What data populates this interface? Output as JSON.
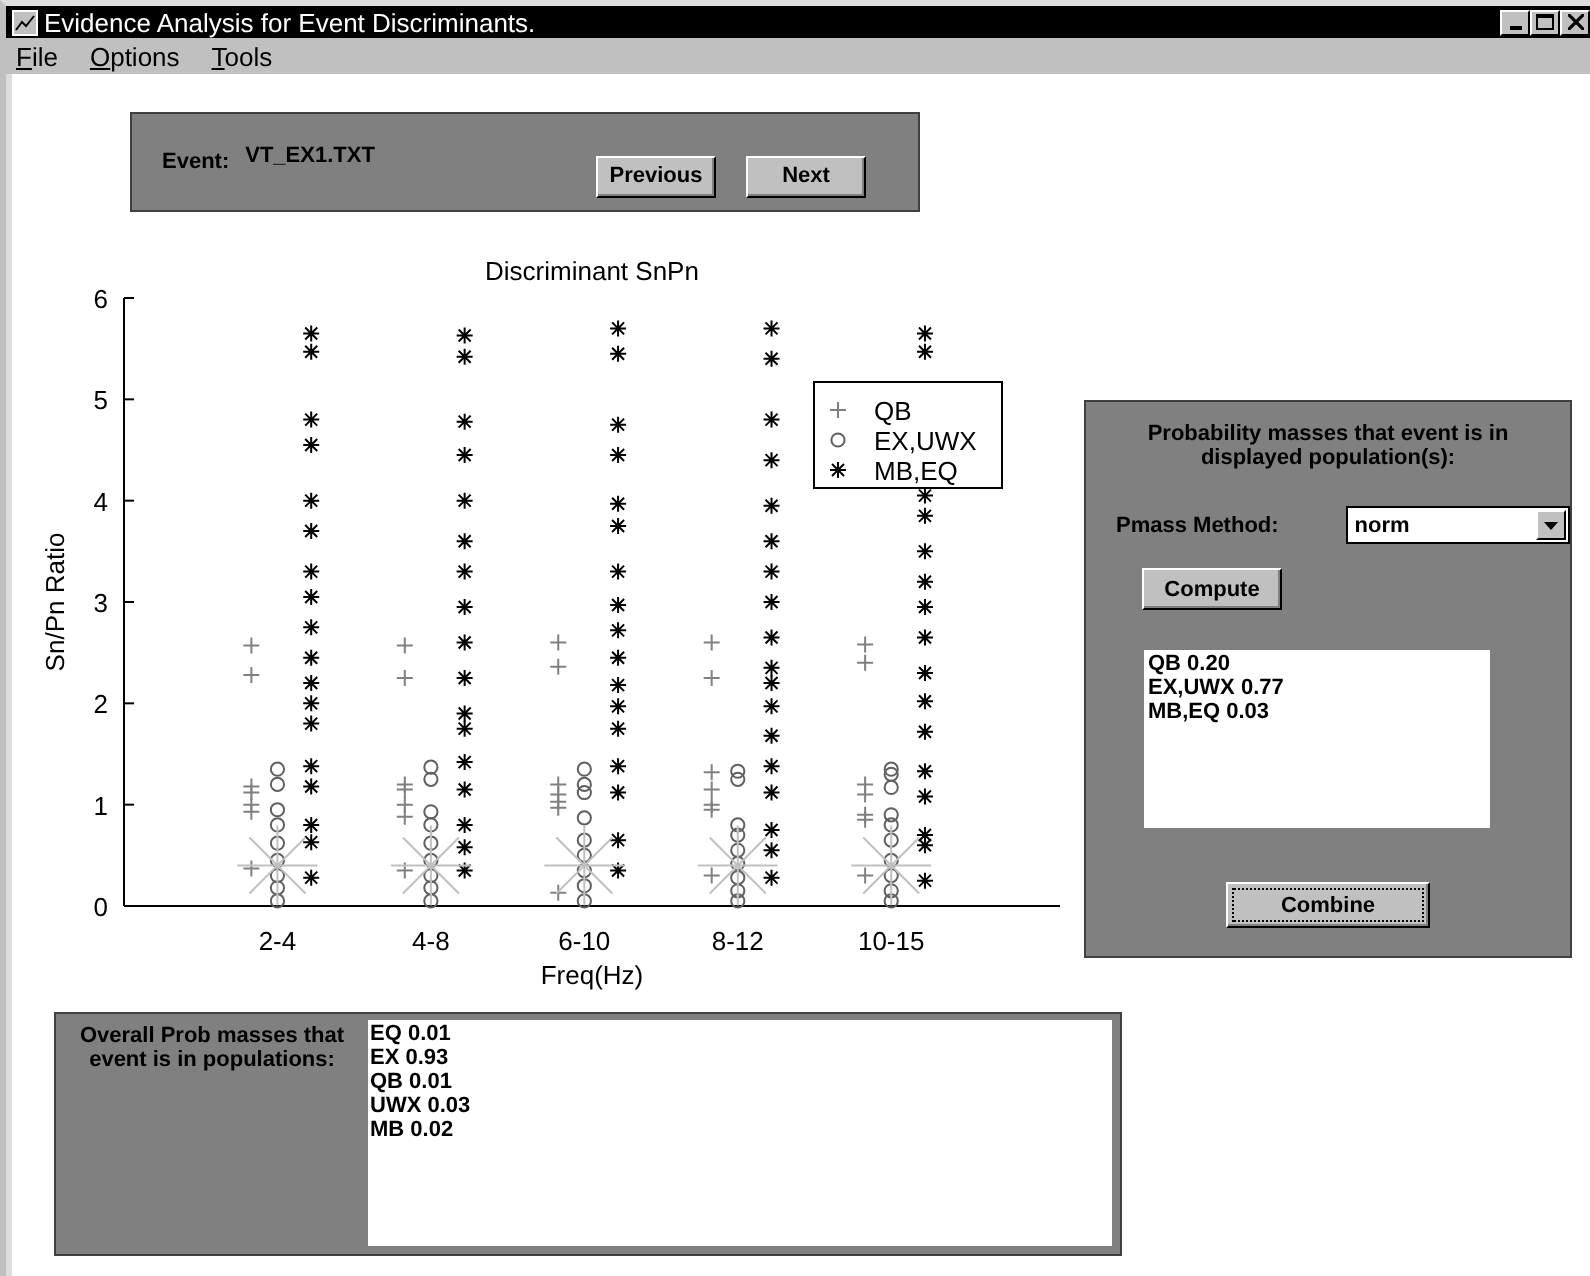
{
  "window": {
    "title": "Evidence Analysis for Event Discriminants."
  },
  "menu": [
    "File",
    "Options",
    "Tools"
  ],
  "event_panel": {
    "label": "Event:",
    "value": "VT_EX1.TXT",
    "buttons": [
      "Previous",
      "Next"
    ]
  },
  "chart": {
    "chart_data": {
      "type": "scatter",
      "title": "Discriminant  SnPn",
      "xlabel": "Freq(Hz)",
      "ylabel": "Sn/Pn Ratio",
      "legend": "upper right",
      "categories": [
        "2-4",
        "4-8",
        "6-10",
        "8-12",
        "10-15"
      ],
      "ylim": [
        0,
        6
      ],
      "yticks": [
        0,
        1,
        2,
        3,
        4,
        5,
        6
      ],
      "series": [
        {
          "name": "QB",
          "color": "#808080",
          "values": [
            2.57,
            2.57,
            2.6,
            2.6,
            2.58
          ]
        },
        {
          "color": "#808080",
          "values": [
            2.28,
            2.25,
            2.36,
            2.25,
            2.4
          ]
        },
        {
          "color": "#808080",
          "values": [
            1.18,
            1.2,
            1.2,
            1.32,
            1.2
          ]
        },
        {
          "color": "#808080",
          "values": [
            1.12,
            1.15,
            1.1,
            1.15,
            1.1
          ]
        },
        {
          "color": "#808080",
          "values": [
            1.0,
            1.0,
            1.03,
            1.0,
            0.9
          ]
        },
        {
          "color": "#808080",
          "values": [
            0.93,
            0.88,
            0.97,
            0.95,
            0.85
          ]
        },
        {
          "color": "#808080",
          "values": [
            0.37,
            0.35,
            0.13,
            0.3,
            0.3
          ]
        },
        {
          "name": "EX,UWX",
          "color": "#606060",
          "values": [
            1.35,
            1.37,
            1.35,
            1.33,
            1.35
          ]
        },
        {
          "color": "#606060",
          "values": [
            1.2,
            1.25,
            1.2,
            1.25,
            1.3
          ]
        },
        {
          "color": "#606060",
          "values": [
            0.95,
            0.93,
            1.12,
            0.8,
            1.17
          ]
        },
        {
          "color": "#606060",
          "values": [
            0.8,
            0.8,
            0.87,
            0.7,
            0.9
          ]
        },
        {
          "color": "#606060",
          "values": [
            0.62,
            0.62,
            0.65,
            0.55,
            0.8
          ]
        },
        {
          "color": "#606060",
          "values": [
            0.45,
            0.45,
            0.5,
            0.42,
            0.65
          ]
        },
        {
          "color": "#606060",
          "values": [
            0.3,
            0.3,
            0.35,
            0.28,
            0.45
          ]
        },
        {
          "color": "#606060",
          "values": [
            0.18,
            0.18,
            0.2,
            0.15,
            0.3
          ]
        },
        {
          "color": "#606060",
          "values": [
            0.05,
            0.05,
            0.05,
            0.05,
            0.15
          ]
        },
        {
          "color": "#606060",
          "values": [
            null,
            null,
            null,
            null,
            0.05
          ]
        },
        {
          "name": "MB,EQ",
          "color": "#000000",
          "values": [
            5.65,
            5.63,
            5.7,
            5.7,
            5.65
          ]
        },
        {
          "color": "#000000",
          "values": [
            5.47,
            5.42,
            5.45,
            5.4,
            5.47
          ]
        },
        {
          "color": "#000000",
          "values": [
            4.8,
            4.78,
            4.75,
            4.8,
            null
          ]
        },
        {
          "color": "#000000",
          "values": [
            4.55,
            4.45,
            4.45,
            4.4,
            4.05
          ]
        },
        {
          "color": "#000000",
          "values": [
            4.0,
            4.0,
            3.97,
            3.95,
            3.85
          ]
        },
        {
          "color": "#000000",
          "values": [
            3.7,
            3.6,
            3.75,
            3.6,
            3.5
          ]
        },
        {
          "color": "#000000",
          "values": [
            3.3,
            3.3,
            3.3,
            3.3,
            3.2
          ]
        },
        {
          "color": "#000000",
          "values": [
            3.05,
            2.95,
            2.97,
            3.0,
            2.95
          ]
        },
        {
          "color": "#000000",
          "values": [
            2.75,
            2.6,
            2.72,
            2.65,
            2.65
          ]
        },
        {
          "color": "#000000",
          "values": [
            2.45,
            2.25,
            2.45,
            2.35,
            2.3
          ]
        },
        {
          "color": "#000000",
          "values": [
            2.2,
            1.9,
            2.18,
            2.2,
            2.02
          ]
        },
        {
          "color": "#000000",
          "values": [
            2.0,
            1.75,
            1.97,
            1.97,
            1.72
          ]
        },
        {
          "color": "#000000",
          "values": [
            1.8,
            1.42,
            1.75,
            1.68,
            1.33
          ]
        },
        {
          "color": "#000000",
          "values": [
            1.38,
            1.15,
            1.38,
            1.38,
            1.08
          ]
        },
        {
          "color": "#000000",
          "values": [
            1.18,
            0.8,
            1.12,
            1.12,
            0.7
          ]
        },
        {
          "color": "#000000",
          "values": [
            0.8,
            0.58,
            0.65,
            0.75,
            0.6
          ]
        },
        {
          "color": "#000000",
          "values": [
            0.63,
            0.35,
            0.35,
            0.55,
            0.25
          ]
        },
        {
          "color": "#000000",
          "values": [
            0.28,
            null,
            null,
            0.28,
            null
          ]
        },
        {
          "color": "#c0c0c0",
          "values": [
            0.4,
            0.4,
            0.4,
            0.4,
            0.4
          ]
        }
      ]
    }
  },
  "mass_panel": {
    "heading": "Probability masses that event is in displayed population(s):",
    "method_label": "Pmass Method:",
    "method_value": "norm",
    "compute_button": "Compute",
    "results": [
      "QB 0.20",
      "EX,UWX 0.77",
      "MB,EQ 0.03"
    ],
    "combine_button": "Combine"
  },
  "overall_panel": {
    "heading": "Overall Prob masses that event is in populations:",
    "results": [
      "EQ 0.01",
      "EX 0.93",
      "QB 0.01",
      "UWX 0.03",
      "MB 0.02"
    ]
  }
}
